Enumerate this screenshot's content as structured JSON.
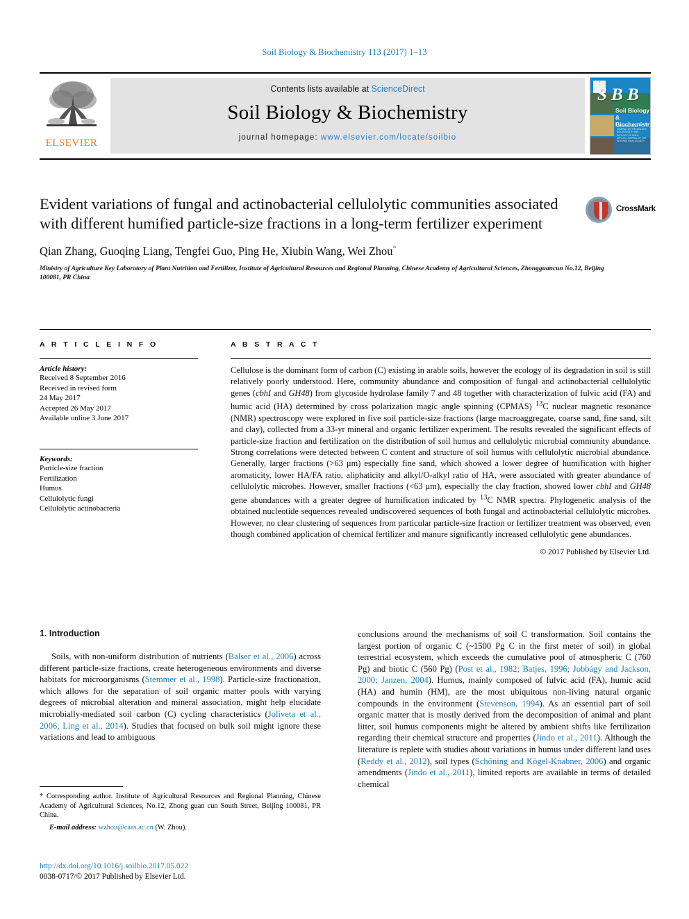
{
  "running_head": "Soil Biology & Biochemistry 113 (2017) 1–13",
  "masthead": {
    "publisher": "ELSEVIER",
    "contents_prefix": "Contents lists available at",
    "contents_link": "ScienceDirect",
    "journal_title": "Soil Biology & Biochemistry",
    "homepage_label": "journal homepage:",
    "homepage_url": "www.elsevier.com/locate/soilbio",
    "cover": {
      "initials": "S B B",
      "name_line_1": "Soil Biology &",
      "name_line_2": "Biochemistry",
      "fine_print": "AN INTERNATIONAL JOURNAL ON THE BIOLOGY, BIOCHEMISTRY AND ECOLOGY OF SOILS. OFFICIAL JOURNAL OF THE INTERNATIONAL SOCIETY"
    }
  },
  "article": {
    "title": "Evident variations of fungal and actinobacterial cellulolytic communities associated with different humified particle-size fractions in a long-term fertilizer experiment",
    "crossmark_label": "CrossMark",
    "authors": "Qian Zhang, Guoqing Liang, Tengfei Guo, Ping He, Xiubin Wang, Wei Zhou",
    "corresponding_marker": "*",
    "affiliation": "Ministry of Agriculture Key Laboratory of Plant Nutrition and Fertilizer, Institute of Agricultural Resources and Regional Planning, Chinese Academy of Agricultural Sciences, Zhongguancun No.12, Beijing 100081, PR China"
  },
  "article_info": {
    "heading": "A R T I C L E   I N F O",
    "history_label": "Article history:",
    "history": [
      "Received 8 September 2016",
      "Received in revised form",
      "24 May 2017",
      "Accepted 26 May 2017",
      "Available online 3 June 2017"
    ],
    "keywords_label": "Keywords:",
    "keywords": [
      "Particle-size fraction",
      "Fertilization",
      "Humus",
      "Cellulolytic fungi",
      "Cellulolytic actinobacteria"
    ]
  },
  "abstract": {
    "heading": "A B S T R A C T",
    "text_part_1": "Cellulose is the dominant form of carbon (C) existing in arable soils, however the ecology of its degradation in soil is still relatively poorly understood. Here, community abundance and composition of fungal and actinobacterial cellulolytic genes (",
    "gene_1": "cbhI",
    "text_part_2": " and ",
    "gene_2": "GH48",
    "text_part_3": ") from glycoside hydrolase family 7 and 48 together with characterization of fulvic acid (FA) and humic acid (HA) determined by cross polarization magic angle spinning (CPMAS) ",
    "sup_1": "13",
    "text_part_4": "C nuclear magnetic resonance (NMR) spectroscopy were explored in five soil particle-size fractions (large macroaggregate, coarse sand, fine sand, silt and clay), collected from a 33-yr mineral and organic fertilizer experiment. The results revealed the significant effects of particle-size fraction and fertilization on the distribution of soil humus and cellulolytic microbial community abundance. Strong correlations were detected between C content and structure of soil humus with cellulolytic microbial abundance. Generally, larger fractions (>63 μm) especially fine sand, which showed a lower degree of humification with higher aromaticity, lower HA/FA ratio, aliphaticity and alkyl/O-alkyl ratio of HA, were associated with greater abundance of cellulolytic microbes. However, smaller fractions (<63 μm), especially the clay fraction, showed lower ",
    "gene_3": "cbhI",
    "text_part_5": " and ",
    "gene_4": "GH48",
    "text_part_6": " gene abundances with a greater degree of humification indicated by ",
    "sup_2": "13",
    "text_part_7": "C NMR spectra. Phylogenetic analysis of the obtained nucleotide sequences revealed undiscovered sequences of both fungal and actinobacterial cellulolytic microbes. However, no clear clustering of sequences from particular particle-size fraction or fertilizer treatment was observed, even though combined application of chemical fertilizer and manure significantly increased cellulolytic gene abundances.",
    "copyright": "© 2017 Published by Elsevier Ltd."
  },
  "introduction": {
    "heading": "1. Introduction",
    "left_p1_a": "Soils, with non-uniform distribution of nutrients (",
    "left_ref1": "Balser et al., 2006",
    "left_p1_b": ") across different particle-size fractions, create heterogeneous environments and diverse habitats for microorganisms (",
    "left_ref2": "Stemmer et al., 1998",
    "left_p1_c": "). Particle-size fractionation, which allows for the separation of soil organic matter pools with varying degrees of microbial alteration and mineral association, might help elucidate microbially-mediated soil carbon (C) cycling characteristics (",
    "left_ref3": "Joliveta et al., 2006; Ling et al., 2014",
    "left_p1_d": "). Studies that focused on bulk soil might ignore these variations and lead to ambiguous",
    "right_p1_a": "conclusions around the mechanisms of soil C transformation. Soil contains the largest portion of organic C (~1500 Pg C in the first meter of soil) in global terrestrial ecosystem, which exceeds the cumulative pool of atmospheric C (760 Pg) and biotic C (560 Pg) (",
    "right_ref1": "Post et al., 1982; Batjes, 1996; Jobbágy and Jackson, 2000; Janzen, 2004",
    "right_p1_b": "). Humus, mainly composed of fulvic acid (FA), humic acid (HA) and humin (HM), are the most ubiquitous non-living natural organic compounds in the environment (",
    "right_ref2": "Stevenson, 1994",
    "right_p1_c": "). As an essential part of soil organic matter that is mostly derived from the decomposition of animal and plant litter, soil humus components might be altered by ambient shifts like fertilization regarding their chemical structure and properties (",
    "right_ref3": "Jindo et al., 2011",
    "right_p1_d": "). Although the literature is replete with studies about variations in humus under different land uses (",
    "right_ref4": "Reddy et al., 2012",
    "right_p1_e": "), soil types (",
    "right_ref5": "Schöning and Kögel-Knabner, 2006",
    "right_p1_f": ") and organic amendments (",
    "right_ref6": "Jindo et al., 2011",
    "right_p1_g": "), limited reports are available in terms of detailed chemical"
  },
  "footnotes": {
    "corresponding_marker": "*",
    "corresponding_text": " Corresponding author. Institute of Agricultural Resources and Regional Planning, Chinese Academy of Agricultural Sciences, No.12, Zhong guan cun South Street, Beijing 100081, PR China.",
    "email_label": "E-mail address:",
    "email": "wzhou@caas.ac.cn",
    "email_suffix": " (W. Zhou).",
    "doi_url": "http://dx.doi.org/10.1016/j.soilbio.2017.05.022",
    "issn_line": "0038-0717/© 2017 Published by Elsevier Ltd."
  },
  "colors": {
    "link_blue": "#1b7fb5",
    "elsevier_orange": "#e87722",
    "cover_blue": "#1a86c4",
    "crossmark_red": "#c0392b"
  }
}
